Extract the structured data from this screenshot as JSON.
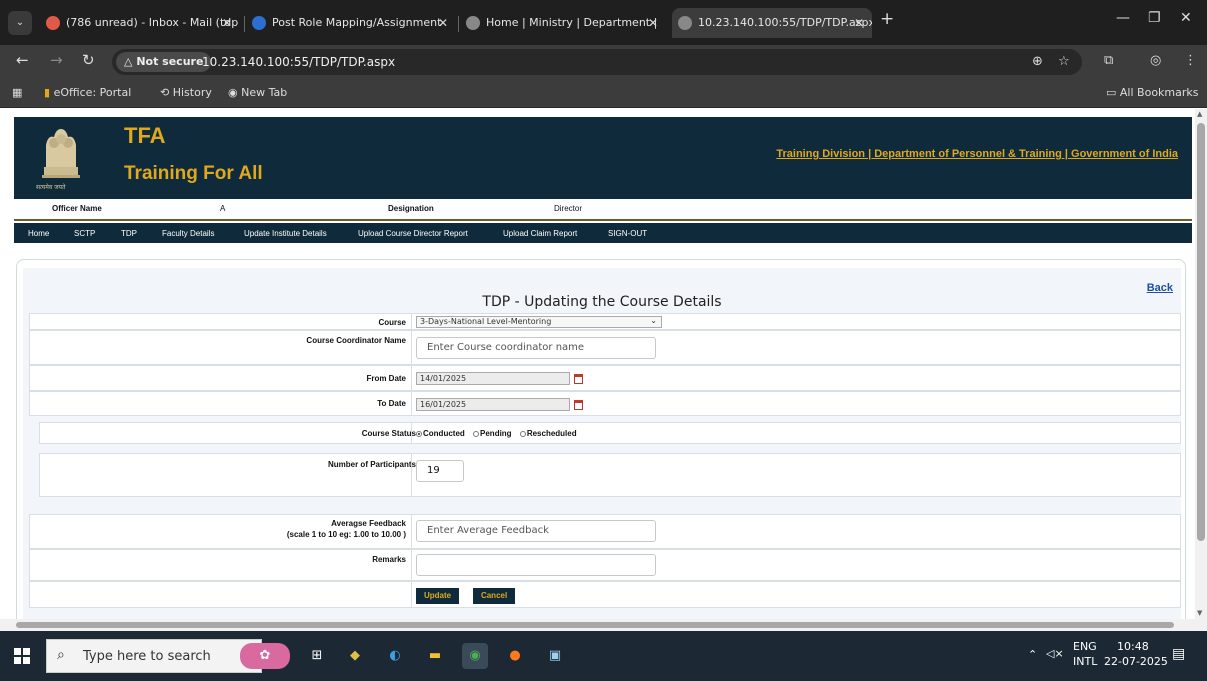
{
  "browser": {
    "tabs": [
      {
        "title": "(786 unread) - Inbox - Mail (tdp",
        "icon": "mail-icon"
      },
      {
        "title": "Post Role Mapping/Assignment",
        "icon": "globe-icon"
      },
      {
        "title": "Home | Ministry | Department |",
        "icon": "globe-icon"
      },
      {
        "title": "10.23.140.100:55/TDP/TDP.aspx",
        "icon": "globe-icon",
        "active": true
      }
    ],
    "not_secure_label": "Not secure",
    "url": "10.23.140.100:55/TDP/TDP.aspx",
    "bookmarks": [
      "eOffice: Portal",
      "History",
      "New Tab"
    ],
    "all_bookmarks_label": "All Bookmarks"
  },
  "site": {
    "logo_title": "TFA",
    "logo_subtitle": "Training For All",
    "department_link": "Training Division | Department of Personnel & Training | Government of India",
    "emblem_caption": "सत्यमेव जयते",
    "officer_name_label": "Officer Name",
    "officer_name_value": "A",
    "designation_label": "Designation",
    "designation_value": "Director",
    "nav": [
      "Home",
      "SCTP",
      "TDP",
      "Faculty Details",
      "Update Institute Details",
      "Upload Course Director Report",
      "Upload Claim Report",
      "SIGN-OUT"
    ]
  },
  "form": {
    "back_label": "Back",
    "title": "TDP - Updating the Course Details",
    "course_label": "Course",
    "course_value": "3-Days-National Level-Mentoring",
    "coordinator_label": "Course Coordinator Name",
    "coordinator_placeholder": "Enter Course coordinator name",
    "from_date_label": "From Date",
    "from_date_value": "14/01/2025",
    "to_date_label": "To Date",
    "to_date_value": "16/01/2025",
    "status_label": "Course Status",
    "status_options": [
      "Conducted",
      "Pending",
      "Rescheduled"
    ],
    "status_selected": "Conducted",
    "participants_label": "Number of Participants",
    "participants_value": "19",
    "feedback_label_line1": "Averagse Feedback",
    "feedback_label_line2": "(scale 1 to 10 eg: 1.00 to 10.00 )",
    "feedback_placeholder": "Enter Average Feedback",
    "remarks_label": "Remarks",
    "remarks_value": "",
    "update_label": "Update",
    "cancel_label": "Cancel"
  },
  "taskbar": {
    "search_placeholder": "Type here to search",
    "lang_line1": "ENG",
    "lang_line2": "INTL",
    "time": "10:48",
    "date": "22-07-2025"
  },
  "colors": {
    "header_bg": "#0f2a3a",
    "accent_gold": "#e0a81c",
    "link_blue": "#1d4ea8"
  }
}
